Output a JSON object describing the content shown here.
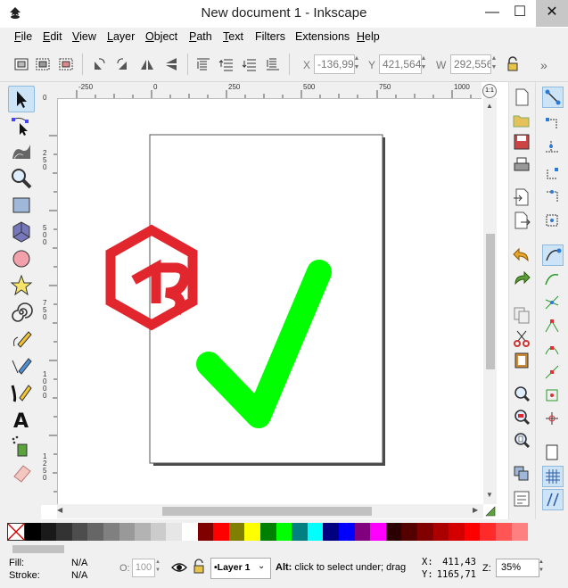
{
  "window": {
    "title": "New document 1 - Inkscape",
    "minimize": "—",
    "maximize": "☐",
    "close": "✕"
  },
  "menu": [
    {
      "label": "File",
      "u": "F",
      "rest": "ile"
    },
    {
      "label": "Edit",
      "u": "E",
      "rest": "dit"
    },
    {
      "label": "View",
      "u": "V",
      "rest": "iew"
    },
    {
      "label": "Layer",
      "u": "L",
      "rest": "ayer"
    },
    {
      "label": "Object",
      "u": "O",
      "rest": "bject"
    },
    {
      "label": "Path",
      "u": "P",
      "rest": "ath"
    },
    {
      "label": "Text",
      "u": "T",
      "rest": "ext"
    },
    {
      "label": "Filters",
      "u": "",
      "rest": "Filters"
    },
    {
      "label": "Extensions",
      "u": "",
      "rest": "Extensions"
    },
    {
      "label": "Help",
      "u": "H",
      "rest": "elp"
    }
  ],
  "toolbar": {
    "x_label": "X",
    "x_value": "-136,99",
    "y_label": "Y",
    "y_value": "421,564",
    "w_label": "W",
    "w_value": "292,556",
    "more": "»"
  },
  "ruler": {
    "h_labels": [
      "-250",
      "0",
      "250",
      "500",
      "750",
      "1000"
    ],
    "v_labels": [
      "0",
      "2 5 0",
      "5 0 0",
      "7 5 0",
      "1 0 0 0",
      "1 2 5 0"
    ],
    "zoom_button": "1:1"
  },
  "tools": [
    "selector-tool",
    "node-tool",
    "tweak-tool",
    "zoom-tool",
    "rectangle-tool",
    "3dbox-tool",
    "ellipse-tool",
    "star-tool",
    "spiral-tool",
    "pencil-tool",
    "pen-tool",
    "calligraphy-tool",
    "text-tool",
    "spray-tool",
    "eraser-tool"
  ],
  "colors": {
    "logo_red": "#e1262d",
    "check_green": "#00ff00",
    "palette": [
      "#000000",
      "#1a1a1a",
      "#333333",
      "#4d4d4d",
      "#666666",
      "#808080",
      "#999999",
      "#b3b3b3",
      "#cccccc",
      "#e6e6e6",
      "#ffffff",
      "#800000",
      "#ff0000",
      "#808000",
      "#ffff00",
      "#008000",
      "#00ff00",
      "#008080",
      "#00ffff",
      "#000080",
      "#0000ff",
      "#800080",
      "#ff00ff",
      "#2b0000",
      "#550000",
      "#800000",
      "#aa0000",
      "#d40000",
      "#ff0000",
      "#ff2a2a",
      "#ff5555",
      "#ff8080"
    ]
  },
  "status": {
    "fill_label": "Fill:",
    "fill_value": "N/A",
    "stroke_label": "Stroke:",
    "stroke_value": "N/A",
    "opacity_label": "O:",
    "opacity_value": "100",
    "layer": "•Layer 1",
    "message_bold": "Alt:",
    "message": " click to select under; drag",
    "x_label": "X:",
    "x_value": "411,43",
    "y_label": "Y:",
    "y_value": "1165,71",
    "zoom_label": "Z:",
    "zoom_value": "35%"
  }
}
